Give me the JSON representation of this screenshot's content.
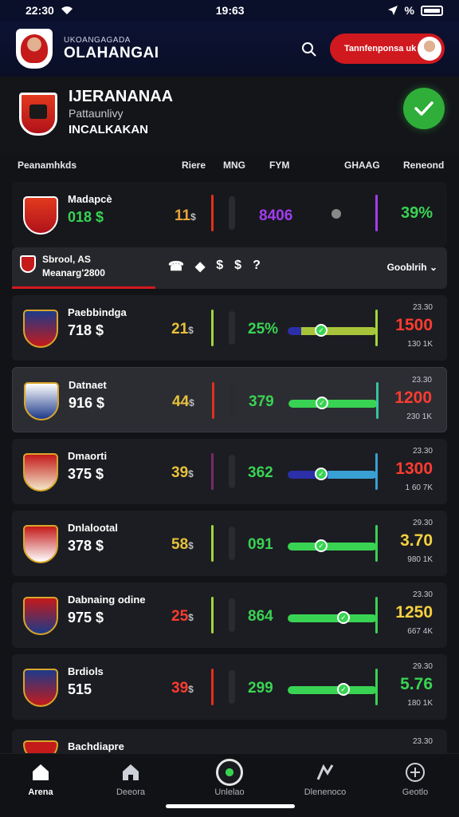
{
  "status": {
    "time": "22:30",
    "center": "19:63",
    "battery": "%"
  },
  "header": {
    "sub": "UKOANGAGADA",
    "title": "OLAHANGAI",
    "pill_label": "Tannfenponsa uk"
  },
  "profile": {
    "name": "IJERANANAA",
    "line2": "Pattaunlivy",
    "line3": "INCALKAKAN"
  },
  "columns": {
    "c1": "Peanamhkds",
    "c2": "Riere",
    "c3": "MNG",
    "c4": "FYM",
    "c5": "GHAAG",
    "c6": "Reneond"
  },
  "top_row": {
    "name": "Madapcè",
    "score": "018 $",
    "pos": "11",
    "pos_sym": "$",
    "mid": "8406",
    "right": "39%"
  },
  "filter": {
    "line1": "Sbrool, AS",
    "line2": "Meanarg'2800",
    "icons": [
      "☎",
      "◆",
      "$",
      "$",
      "?"
    ],
    "sort_label": "Gooblrih"
  },
  "rows": [
    {
      "name": "Paebbindga",
      "score": "718 $",
      "pos": "21",
      "pos_sym": "$",
      "pct": "25%",
      "s1": "23.30",
      "big": "1500",
      "s2": "130 1K",
      "pos_color": "#e8c13a",
      "pct_color": "#39d353",
      "big_color": "#ff3b30",
      "fill": 0.55
    },
    {
      "name": "Datnaet",
      "score": "916 $",
      "pos": "44",
      "pos_sym": "$",
      "pct": "379",
      "s1": "23.30",
      "big": "1200",
      "s2": "230 1K",
      "pos_color": "#e8c13a",
      "pct_color": "#39d353",
      "big_color": "#ff3b30",
      "fill": 0.55
    },
    {
      "name": "Dmaorti",
      "score": "375 $",
      "pos": "39",
      "pos_sym": "$",
      "pct": "362",
      "s1": "23.30",
      "big": "1300",
      "s2": "1 60 7K",
      "pos_color": "#e8c13a",
      "pct_color": "#39d353",
      "big_color": "#ff3b30",
      "fill": 0.55
    },
    {
      "name": "Dnlalootal",
      "score": "378 $",
      "pos": "58",
      "pos_sym": "$",
      "pct": "091",
      "s1": "29.30",
      "big": "3.70",
      "s2": "980 1K",
      "pos_color": "#e8c13a",
      "pct_color": "#39d353",
      "big_color": "#f4d03f",
      "fill": 0.55
    },
    {
      "name": "Dabnaing odine",
      "score": "975 $",
      "pos": "25",
      "pos_sym": "$",
      "pct": "864",
      "s1": "23.30",
      "big": "1250",
      "s2": "667 4K",
      "pos_color": "#ff3b30",
      "pct_color": "#39d353",
      "big_color": "#f4d03f",
      "fill": 1.0
    },
    {
      "name": "Brdiols",
      "score": "515",
      "pos": "39",
      "pos_sym": "$",
      "pct": "299",
      "s1": "29.30",
      "big": "5.76",
      "s2": "180 1K",
      "pos_color": "#ff3b30",
      "pct_color": "#39d353",
      "big_color": "#39d353",
      "fill": 1.0
    }
  ],
  "partial_row": {
    "name": "Bachdiapre",
    "s1": "23.30"
  },
  "nav": [
    "Arena",
    "Deeora",
    "Unlelao",
    "Dlenenoco",
    "Geotlo"
  ],
  "colors": {
    "accent": "#d0191f",
    "green": "#2fae3a",
    "bg": "#121317"
  }
}
